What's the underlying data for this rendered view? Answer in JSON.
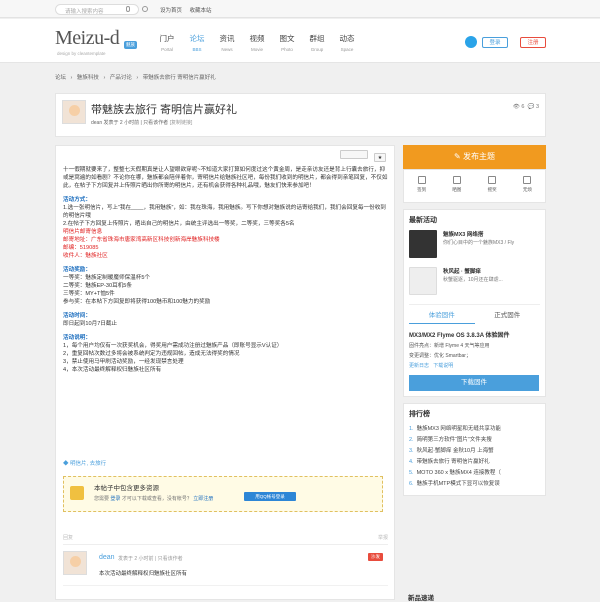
{
  "topbar": {
    "search_placeholder": "请输入搜索内容",
    "links": [
      "设为首页",
      "收藏本站"
    ]
  },
  "header": {
    "logo_text": "Meizu-d",
    "logo_badge": "魅族",
    "logo_sub": "design by cleantemplate",
    "nav": [
      {
        "cn": "门户",
        "en": "Portal"
      },
      {
        "cn": "论坛",
        "en": "BBS"
      },
      {
        "cn": "资讯",
        "en": "News"
      },
      {
        "cn": "视频",
        "en": "Movie"
      },
      {
        "cn": "图文",
        "en": "Photo"
      },
      {
        "cn": "群组",
        "en": "Group"
      },
      {
        "cn": "动态",
        "en": "Space"
      }
    ],
    "login": "登录",
    "register": "注册"
  },
  "breadcrumb": [
    "论坛",
    "›",
    "魅族科技",
    "›",
    "产品讨论",
    "›",
    "带魅族去旅行 寄明信片赢好礼"
  ],
  "thread": {
    "title": "带魅族去旅行 寄明信片赢好礼",
    "author": "dean",
    "meta": "发表于 2 小时前",
    "only_author": "只看该作者",
    "badge": "[复制链接]",
    "views": "6",
    "replies": "3"
  },
  "content": {
    "intro": "十一假期就要来了，整整七天假期真是让人望眼欲穿呢~不知道大家打算如何度过这个黄金周，是走亲访友还是背上行囊去旅行，抑或是窝遍的如看剧？不论你在哪，魅族都会陪伴着你，寄明信片给魅族社区吧，每份我们收到的明信片，都会得到亲笔回复，不仅如此，在帖子下方回复并上传照片晒出你所寄的明信片，还有机会获得各种礼品哦，魅友们快来参加吧！",
    "method_title": "活动方式：",
    "method_1": "1.选一张明信片，写上“我在____，我用魅族”，如：我在珠海，我用魅族。写下你想对魅族说的话寄给我们，我们会回复每一份收到的明信片哦",
    "method_2": "2.在帖子下方回复上传照片，晒出自己的明信片，由统主评选出一等奖，二等奖，三等奖各5名",
    "addr_title": "明信片邮寄信息",
    "addr_line": "邮寄地址：广东省珠海市唐家湾高新区科技创新海岸魅族科技楼",
    "zip_line": "邮编：519085",
    "recv_line": "收件人：魅族社区",
    "prize_title": "活动奖励：",
    "prize_1": "一等奖：魅族定制暖魔师保温杯5个",
    "prize_2": "二等奖：魅族EP-30耳机5条",
    "prize_3": "三等奖：MY+T恤5件",
    "prize_4": "参与奖：在本帖下方回复即将获得100魅币和100魅力的奖励",
    "time_title": "活动时间：",
    "time_line": "即日起到10月7日截止",
    "rule_title": "活动说明：",
    "rule_1": "1，每个用户均仅有一次获奖机会，得奖用户需成功注册过魅族产品（即账号显示V认证）",
    "rule_2": "2，重复回帖次数过多将会被系统判定为违规回帖，造成无法得奖的情况",
    "rule_3": "3，禁止使用马甲刷活动奖励，一经发现禁言处理",
    "rule_4": "4，本次活动最终解释权归魅族社区所有",
    "tag": "明信片, 去旅行"
  },
  "hidebox": {
    "title": "本帖子中包含更多资源",
    "desc_pre": "您需要",
    "login": "登录",
    "desc_mid": "才可以下载或查看，没有帐号？",
    "register": "立即注册",
    "qq": "用QQ帐号登录"
  },
  "reply_bar": {
    "left": "回复",
    "right": "举报"
  },
  "comment": {
    "name": "dean",
    "meta": "发表于 2 小时前 | 只看该作者",
    "sofa": "沙发",
    "text": "本次活动最终解释权归魅族社区所有"
  },
  "sidebar": {
    "post_btn": "发布主题",
    "icons": [
      "签到",
      "晒图",
      "摇奖",
      "无烦"
    ],
    "activity_title": "最新活动",
    "acts": [
      {
        "title": "魅族MX3 网络搭",
        "desc": "你们心目中的一个魅族MX3 / Fly"
      },
      {
        "title": "秋风起 · 蟹脚痒",
        "desc": "秋蟹驱逐，10月还在肆虐..."
      }
    ],
    "tabs": [
      "体验固件",
      "正式固件"
    ],
    "fw_title": "MX3/MX2 Flyme OS 3.8.3A 体验固件",
    "fw_lines": [
      "固件亮点：新增 Flyme 4 天气等应用",
      "变更调整：优化 Smartbar；"
    ],
    "fw_links": [
      "更新日志",
      "下载说明"
    ],
    "dl_btn": "下载固件",
    "rank_title": "排行榜",
    "ranks": [
      "魅族MX3 网络明星和无缝共享功能",
      "简明第三方软件“图片”文件夹搜",
      "秋风起·蟹脚痒 金秋10月 上海蟹",
      "带魅族去旅行 寄明信片赢好礼",
      "MOTO 360 x 魅族MX4 连接教程（",
      "魅族手机MTP模式下显可以恢复误"
    ],
    "bottom_title": "新品速递"
  }
}
